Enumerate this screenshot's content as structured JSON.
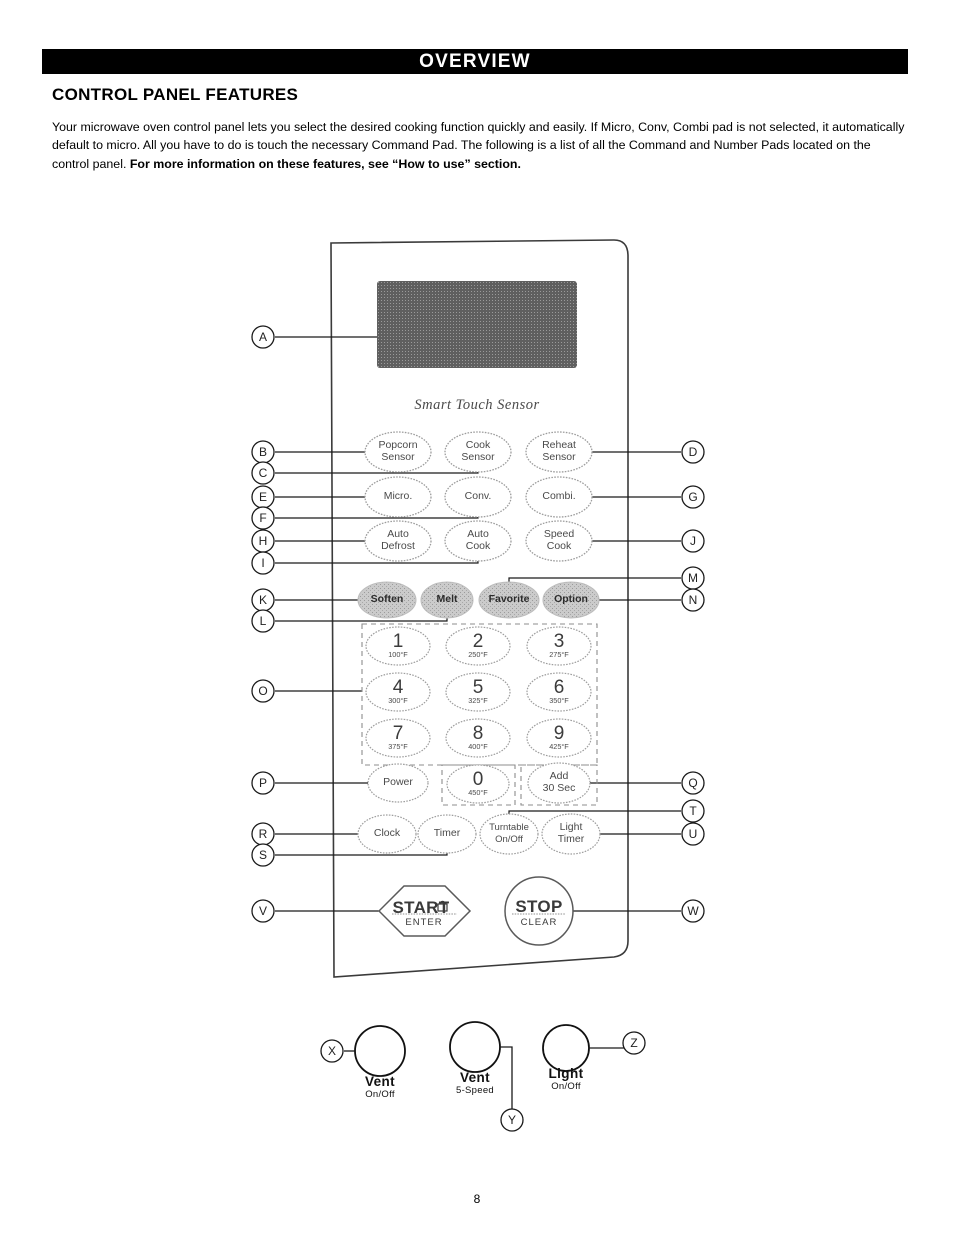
{
  "header": {
    "banner": "OVERVIEW",
    "section_title": "CONTROL PANEL FEATURES",
    "intro_part1": "Your microwave oven control panel lets you select the desired cooking function quickly and easily. If Micro, Conv, Combi pad is not selected, it automatically default to micro. All you have to do is touch the necessary Command Pad. The following is a list of all the Command and Number Pads located on the control panel. ",
    "intro_bold": "For more information on these features, see “How to use” section."
  },
  "page_number": "8",
  "panel": {
    "display_caption": "Smart Touch Sensor",
    "sensor_row": [
      {
        "line1": "Popcorn",
        "line2": "Sensor"
      },
      {
        "line1": "Cook",
        "line2": "Sensor"
      },
      {
        "line1": "Reheat",
        "line2": "Sensor"
      }
    ],
    "mode_row": [
      {
        "line1": "Micro.",
        "line2": ""
      },
      {
        "line1": "Conv.",
        "line2": ""
      },
      {
        "line1": "Combi.",
        "line2": ""
      }
    ],
    "auto_row": [
      {
        "line1": "Auto",
        "line2": "Defrost"
      },
      {
        "line1": "Auto",
        "line2": "Cook"
      },
      {
        "line1": "Speed",
        "line2": "Cook"
      }
    ],
    "shaded_row": [
      {
        "line1": "Soften",
        "line2": ""
      },
      {
        "line1": "Melt",
        "line2": ""
      },
      {
        "line1": "Favorite",
        "line2": ""
      },
      {
        "line1": "Option",
        "line2": ""
      }
    ],
    "number_pad": [
      {
        "digit": "1",
        "temp": "100°F"
      },
      {
        "digit": "2",
        "temp": "250°F"
      },
      {
        "digit": "3",
        "temp": "275°F"
      },
      {
        "digit": "4",
        "temp": "300°F"
      },
      {
        "digit": "5",
        "temp": "325°F"
      },
      {
        "digit": "6",
        "temp": "350°F"
      },
      {
        "digit": "7",
        "temp": "375°F"
      },
      {
        "digit": "8",
        "temp": "400°F"
      },
      {
        "digit": "9",
        "temp": "425°F"
      }
    ],
    "zero_key": {
      "digit": "0",
      "temp": "450°F"
    },
    "power_key": {
      "line1": "Power",
      "line2": ""
    },
    "add30_key": {
      "line1": "Add",
      "line2": "30 Sec"
    },
    "clock_key": {
      "line1": "Clock",
      "line2": ""
    },
    "timer_key": {
      "line1": "Timer",
      "line2": ""
    },
    "turntable_key": {
      "line1": "Turntable",
      "line2": "On/Off"
    },
    "light_timer_key": {
      "line1": "Light",
      "line2": "Timer"
    },
    "start_key": {
      "main": "START",
      "sub": "ENTER",
      "lock_icon": "lock-icon"
    },
    "stop_key": {
      "main": "STOP",
      "sub": "CLEAR"
    }
  },
  "knobs": [
    {
      "line1": "Vent",
      "line2": "On/Off",
      "callout": "X"
    },
    {
      "line1": "Vent",
      "line2": "5-Speed",
      "callout": "Y"
    },
    {
      "line1": "Light",
      "line2": "On/Off",
      "callout": "Z"
    }
  ],
  "callouts": {
    "left": [
      "A",
      "B",
      "C",
      "E",
      "F",
      "H",
      "I",
      "K",
      "L",
      "O",
      "P",
      "R",
      "S",
      "V"
    ],
    "right": [
      "D",
      "G",
      "J",
      "M",
      "N",
      "Q",
      "T",
      "U",
      "W"
    ]
  },
  "colors": {
    "banner_bg": "#000000",
    "display_fill": "#5c5c5c",
    "shaded_key_fill": "#c9c9c9",
    "outline": "#3a3a3a"
  }
}
